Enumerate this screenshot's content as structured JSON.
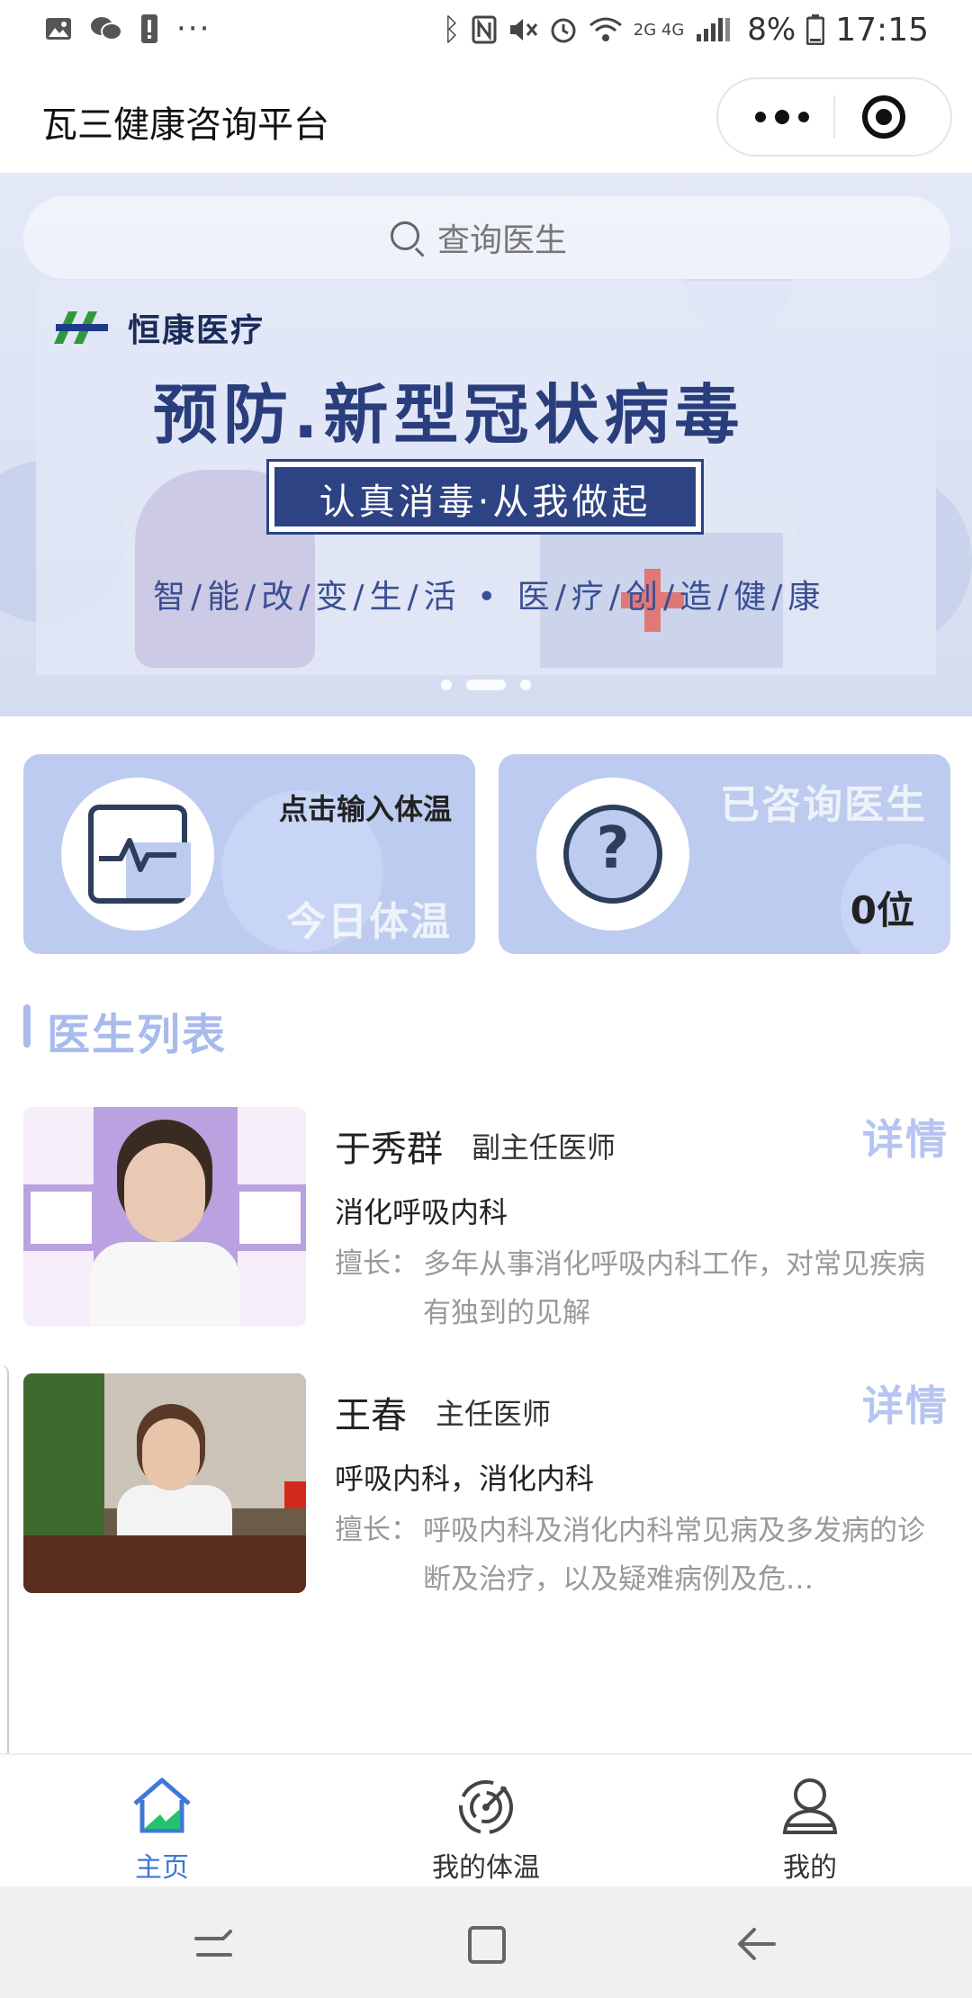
{
  "status_bar": {
    "battery": "8%",
    "time": "17:15",
    "network": "2G 4G",
    "icons_left": [
      "image-icon",
      "wechat-icon",
      "alert-icon",
      "more-dots-icon"
    ],
    "icons_right": [
      "bluetooth-icon",
      "nfc-icon",
      "mute-icon",
      "alarm-icon",
      "wifi-icon",
      "signal-icon",
      "battery-icon"
    ]
  },
  "header": {
    "title": "瓦三健康咨询平台"
  },
  "banner": {
    "search_placeholder": "查询医生",
    "logo": "恒康医疗",
    "headline": "预防.新型冠状病毒",
    "subheadline": "认真消毒·从我做起",
    "slogan": "智/能/改/变/生/活 • 医/疗/创/造/健/康",
    "slide_count": 3,
    "active_slide": 2
  },
  "cards": {
    "temperature": {
      "title": "点击输入体温",
      "watermark": "今日体温"
    },
    "consulted": {
      "watermark": "已咨询医生",
      "count": "0位"
    }
  },
  "section": {
    "title": "医生列表"
  },
  "doctors": [
    {
      "name": "于秀群",
      "title": "副主任医师",
      "department": "消化呼吸内科",
      "skill_label": "擅长：",
      "skill": "多年从事消化呼吸内科工作，对常见疾病有独到的见解",
      "detail_label": "详情"
    },
    {
      "name": "王春",
      "title": "主任医师",
      "department": "呼吸内科，消化内科",
      "skill_label": "擅长：",
      "skill": "呼吸内科及消化内科常见病及多发病的诊断及治疗，以及疑难病例及危…",
      "detail_label": "详情"
    }
  ],
  "tab_bar": {
    "items": [
      {
        "label": "主页",
        "icon": "home-icon",
        "active": true
      },
      {
        "label": "我的体温",
        "icon": "temperature-scan-icon",
        "active": false
      },
      {
        "label": "我的",
        "icon": "user-icon",
        "active": false
      }
    ]
  },
  "colors": {
    "accent": "#3e79d6",
    "card_bg": "#bccbef",
    "section_title": "#a9bbec",
    "detail_label": "#b5c4f0",
    "banner_navy": "#2e4384"
  }
}
